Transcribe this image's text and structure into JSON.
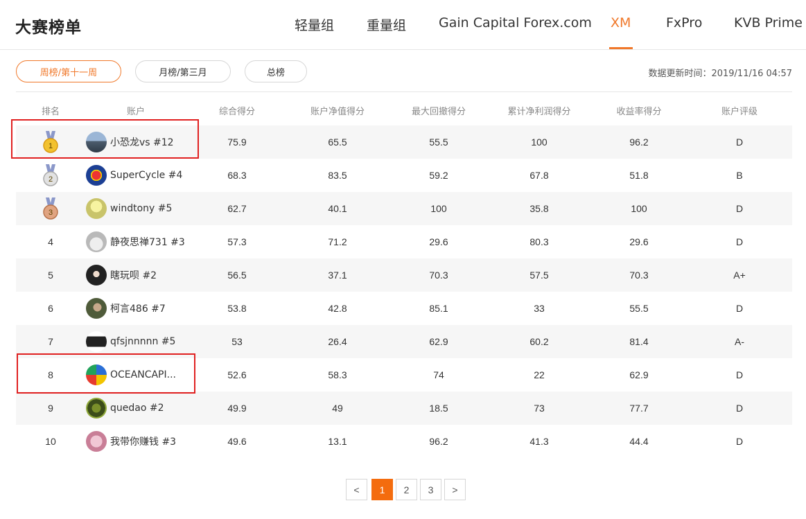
{
  "header": {
    "title": "大赛榜单",
    "tabs": [
      {
        "label": "轻量组"
      },
      {
        "label": "重量组"
      },
      {
        "label": "Gain Capital Forex.com"
      },
      {
        "label": "XM",
        "active": true
      },
      {
        "label": "FxPro"
      },
      {
        "label": "KVB Prime"
      }
    ]
  },
  "filters": [
    {
      "label": "周榜/第十一周",
      "active": true
    },
    {
      "label": "月榜/第三月"
    },
    {
      "label": "总榜"
    }
  ],
  "updated_text": "数据更新时间：2019/11/16 04:57",
  "columns": [
    "排名",
    "账户",
    "综合得分",
    "账户净值得分",
    "最大回撤得分",
    "累计净利润得分",
    "收益率得分",
    "账户评级"
  ],
  "rows": [
    {
      "rank": "1",
      "medal": "gold-medal-icon",
      "avatar": "avatar-landscape",
      "account": "小恐龙vs #12",
      "composite": "75.9",
      "equity": "65.5",
      "drawdown": "55.5",
      "profit": "100",
      "return": "96.2",
      "rating": "D"
    },
    {
      "rank": "2",
      "medal": "silver-medal-icon",
      "avatar": "avatar-superman",
      "account": "SuperCycle #4",
      "composite": "68.3",
      "equity": "83.5",
      "drawdown": "59.2",
      "profit": "67.8",
      "return": "51.8",
      "rating": "B"
    },
    {
      "rank": "3",
      "medal": "bronze-medal-icon",
      "avatar": "avatar-yellow",
      "account": "windtony #5",
      "composite": "62.7",
      "equity": "40.1",
      "drawdown": "100",
      "profit": "35.8",
      "return": "100",
      "rating": "D"
    },
    {
      "rank": "4",
      "avatar": "avatar-rabbit",
      "account": "静夜思禅731 #3",
      "composite": "57.3",
      "equity": "71.2",
      "drawdown": "29.6",
      "profit": "80.3",
      "return": "29.6",
      "rating": "D"
    },
    {
      "rank": "5",
      "avatar": "avatar-dark-person",
      "account": "瞎玩呗 #2",
      "composite": "56.5",
      "equity": "37.1",
      "drawdown": "70.3",
      "profit": "57.5",
      "return": "70.3",
      "rating": "A+"
    },
    {
      "rank": "6",
      "avatar": "avatar-portrait",
      "account": "柯言486 #7",
      "composite": "53.8",
      "equity": "42.8",
      "drawdown": "85.1",
      "profit": "33",
      "return": "55.5",
      "rating": "D"
    },
    {
      "rank": "7",
      "avatar": "avatar-device",
      "account": "qfsjnnnnn #5",
      "composite": "53",
      "equity": "26.4",
      "drawdown": "62.9",
      "profit": "60.2",
      "return": "81.4",
      "rating": "A-"
    },
    {
      "rank": "8",
      "avatar": "avatar-colorful-logo",
      "account": "OCEANCAPI...",
      "composite": "52.6",
      "equity": "58.3",
      "drawdown": "74",
      "profit": "22",
      "return": "62.9",
      "rating": "D"
    },
    {
      "rank": "9",
      "avatar": "avatar-green-pattern",
      "account": "quedao #2",
      "composite": "49.9",
      "equity": "49",
      "drawdown": "18.5",
      "profit": "73",
      "return": "77.7",
      "rating": "D"
    },
    {
      "rank": "10",
      "avatar": "avatar-pink",
      "account": "我带你赚钱 #3",
      "composite": "49.6",
      "equity": "13.1",
      "drawdown": "96.2",
      "profit": "41.3",
      "return": "44.4",
      "rating": "D"
    }
  ],
  "pagination": {
    "prev": "<",
    "pages": [
      "1",
      "2",
      "3"
    ],
    "current": "1",
    "next": ">"
  },
  "colors": {
    "accent": "#f0782a",
    "highlight": "#e02020",
    "stripe": "#f6f6f6"
  }
}
